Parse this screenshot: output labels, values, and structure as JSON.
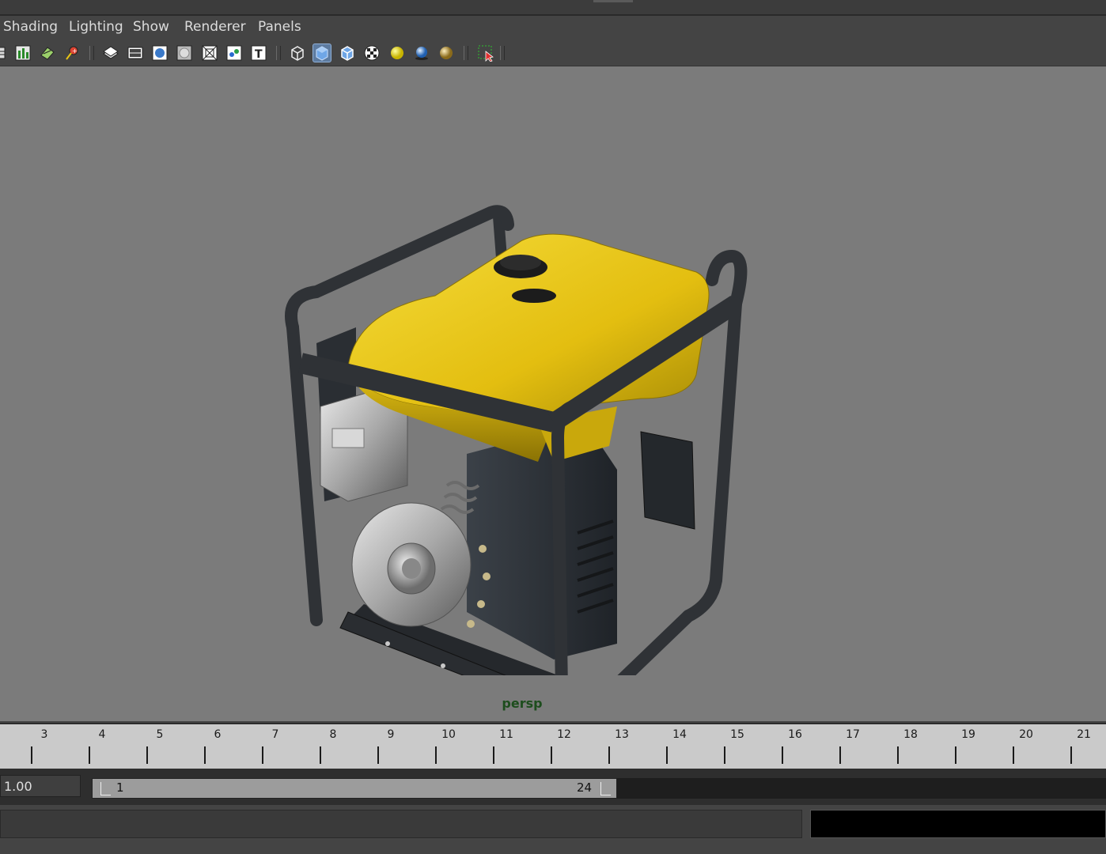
{
  "menubar": {
    "items": [
      "Shading",
      "Lighting",
      "Show",
      "Renderer",
      "Panels"
    ]
  },
  "toolbar": {
    "icons": [
      "grid-icon",
      "graph-editor-icon",
      "camera-attributes-icon",
      "bookmark-camera-icon",
      "image-plane-icon",
      "film-gate-icon",
      "resolution-gate-icon",
      "gate-mask-icon",
      "field-chart-icon",
      "safe-action-icon",
      "safe-title-icon",
      "wireframe-cube-icon",
      "smooth-shade-cube-icon",
      "wireframe-on-shaded-icon",
      "textured-icon",
      "use-default-lights-icon",
      "shadows-icon",
      "high-quality-icon",
      "isolate-select-icon"
    ],
    "active_icon": "smooth-shade-cube-icon"
  },
  "viewport": {
    "camera_label": "persp",
    "background_color": "#7b7b7b",
    "object": "generator-model",
    "tank_color": "#e8c414",
    "frame_color": "#2f3236"
  },
  "timeline": {
    "ticks": [
      "3",
      "4",
      "5",
      "6",
      "7",
      "8",
      "9",
      "10",
      "11",
      "12",
      "13",
      "14",
      "15",
      "16",
      "17",
      "18",
      "19",
      "20",
      "21"
    ]
  },
  "range": {
    "current_time": "1.00",
    "start": "1",
    "end": "24"
  },
  "command_line": {
    "input_value": "",
    "result_value": ""
  }
}
